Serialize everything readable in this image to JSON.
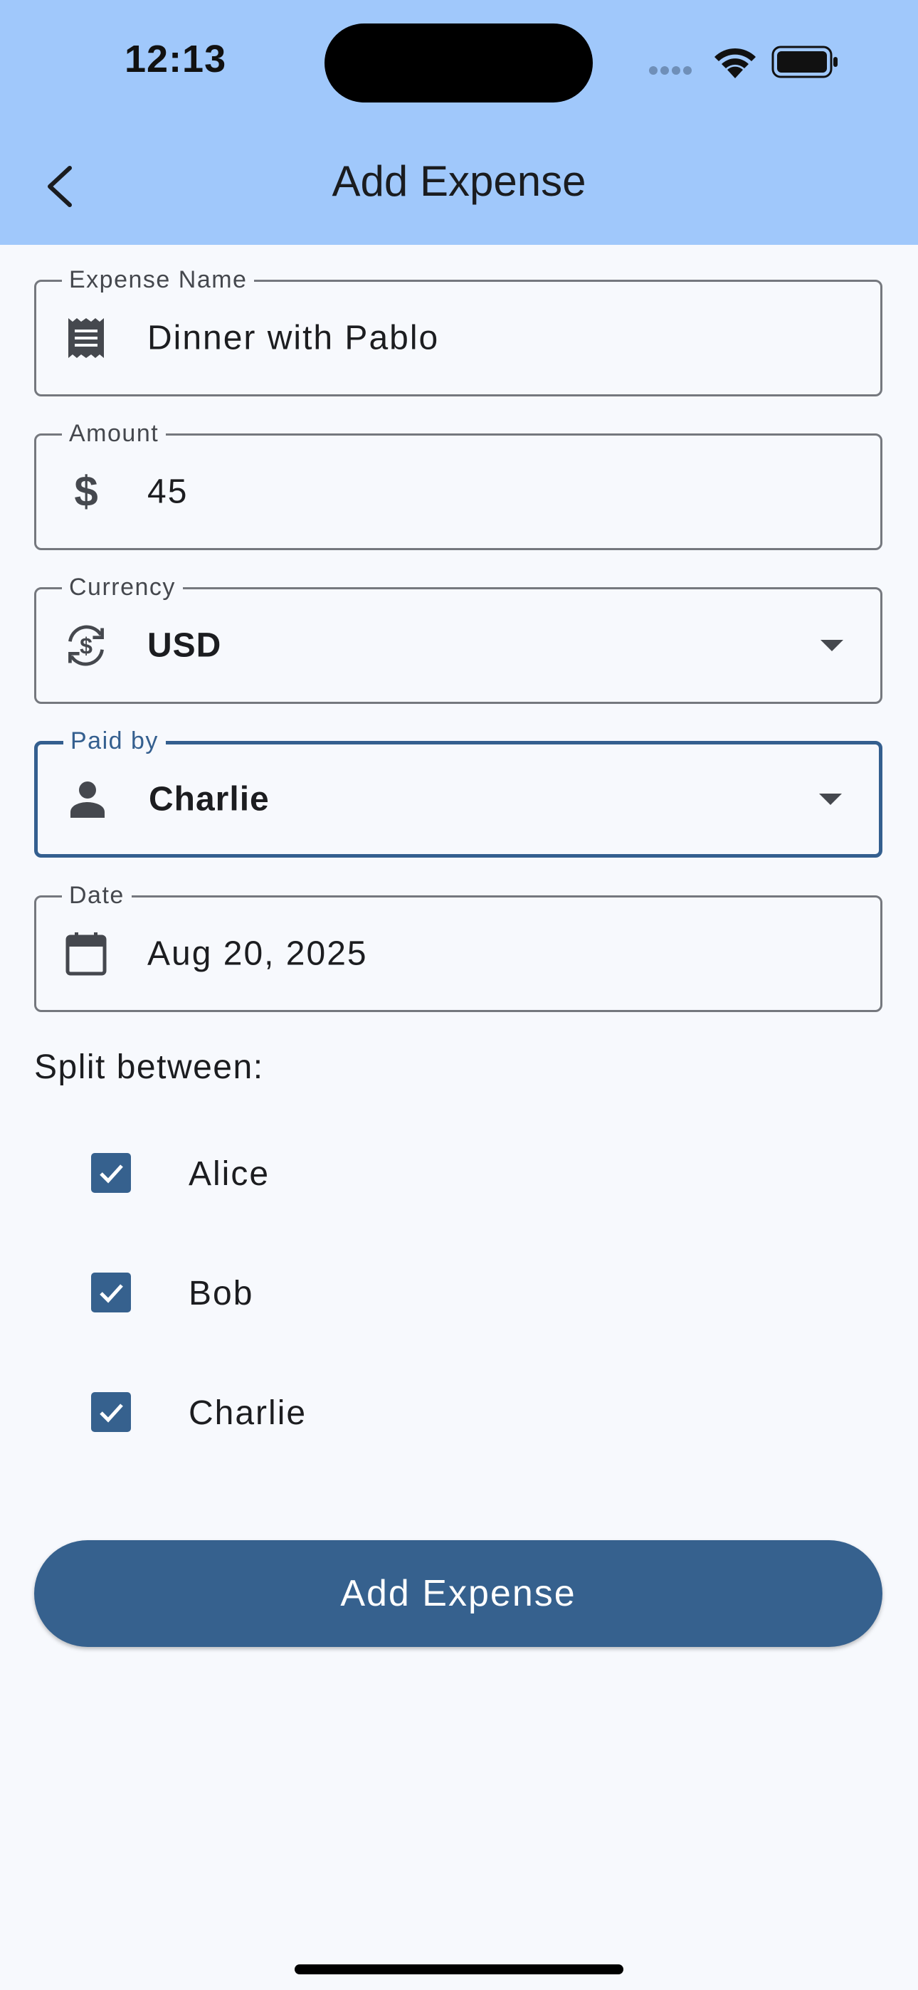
{
  "status_bar": {
    "time": "12:13"
  },
  "header": {
    "title": "Add Expense"
  },
  "fields": {
    "expense_name": {
      "label": "Expense Name",
      "value": "Dinner with Pablo",
      "icon": "receipt-icon"
    },
    "amount": {
      "label": "Amount",
      "value": "45",
      "icon": "dollar-icon"
    },
    "currency": {
      "label": "Currency",
      "value": "USD",
      "icon": "currency-exchange-icon"
    },
    "paid_by": {
      "label": "Paid by",
      "value": "Charlie",
      "icon": "person-icon"
    },
    "date": {
      "label": "Date",
      "value": "Aug 20, 2025",
      "icon": "calendar-icon"
    }
  },
  "split": {
    "label": "Split between:",
    "members": [
      {
        "name": "Alice",
        "checked": true
      },
      {
        "name": "Bob",
        "checked": true
      },
      {
        "name": "Charlie",
        "checked": true
      }
    ]
  },
  "submit": {
    "label": "Add Expense"
  },
  "colors": {
    "appbar": "#a0c8fb",
    "primary": "#36618e",
    "background": "#f7f9fd"
  }
}
